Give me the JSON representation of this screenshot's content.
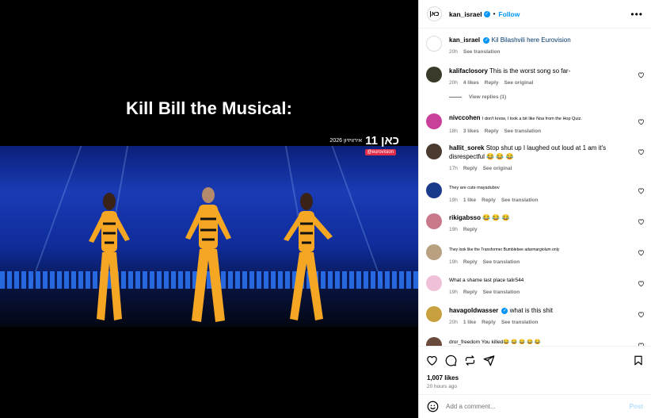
{
  "media": {
    "caption": "Kill Bill the Musical:",
    "broadcaster_logo": "כאן",
    "channel_number": "11",
    "event_text": "אירוויזיון 2026",
    "tag_text": "@eurovision"
  },
  "post": {
    "username": "kan_israel",
    "dot": "•",
    "follow_label": "Follow",
    "more_label": "•••",
    "avatar_text": "|כא",
    "caption_user": "kan_israel",
    "caption_text": "Kil Bilashvili here Eurovision",
    "caption_time": "20h",
    "caption_translation": "See translation",
    "likes": "1,007 likes",
    "time_ago": "20 hours ago"
  },
  "comments": [
    {
      "user": "kalifaclosory",
      "text": "This is the worst song so far-",
      "time": "20h",
      "likes": "4 likes",
      "reply": "Reply",
      "extra": "See original",
      "avatar_color": "#3a3a2a"
    },
    {
      "user": "nivccohen",
      "text": "I don't know, I look a bit like Noa from the Hop Quiz.",
      "time": "18h",
      "likes": "3 likes",
      "reply": "Reply",
      "extra": "See translation",
      "avatar_color": "#c9409a"
    },
    {
      "user": "hallit_sorek",
      "text": "Stop shut up I laughed out loud at 1 am it's disrespectful 😂 😂 😂",
      "time": "17h",
      "likes": "",
      "reply": "Reply",
      "extra": "See original",
      "avatar_color": "#4a3a30"
    },
    {
      "user": "",
      "text": "They are cute mayadubov",
      "time": "19h",
      "likes": "1 like",
      "reply": "Reply",
      "extra": "See translation",
      "avatar_color": "#1a3a8a"
    },
    {
      "user": "rikigabsso",
      "text": "😂 😂 😂",
      "time": "19h",
      "likes": "",
      "reply": "Reply",
      "extra": "",
      "avatar_color": "#c97a8a"
    },
    {
      "user": "",
      "text": "They look like the Transformer Bumblebee adarmargiolum only",
      "time": "19h",
      "likes": "",
      "reply": "Reply",
      "extra": "See translation",
      "avatar_color": "#b8a080"
    },
    {
      "user": "",
      "text": "What a shame last place talir544",
      "time": "19h",
      "likes": "",
      "reply": "Reply",
      "extra": "See translation",
      "avatar_color": "#f0c0d8"
    },
    {
      "user": "havagoldwasser",
      "text": "what is this shit",
      "time": "20h",
      "likes": "1 like",
      "reply": "Reply",
      "extra": "See translation",
      "avatar_color": "#c9a040"
    },
    {
      "user": "",
      "text": "dror_freedom You killed😂 😂 😂 😂 😂",
      "time": "",
      "likes": "",
      "reply": "",
      "extra": "",
      "avatar_color": "#6a4a3a"
    }
  ],
  "view_replies": "View replies (1)",
  "composer": {
    "placeholder": "Add a comment...",
    "post_label": "Post"
  }
}
